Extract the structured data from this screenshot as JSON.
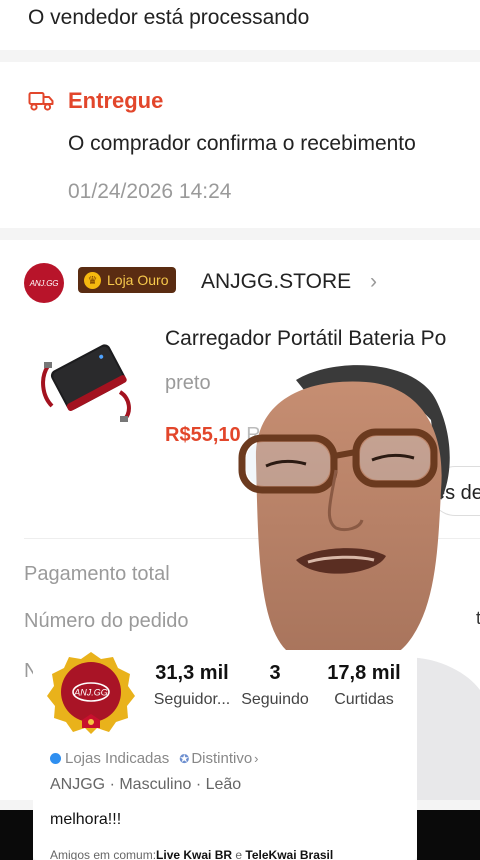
{
  "status": {
    "processing_text": "O vendedor está processando",
    "delivered_title": "Entregue",
    "delivered_desc": "O comprador confirma o recebimento",
    "delivered_time": "01/24/2026 14:24"
  },
  "store": {
    "logo_text": "ANJ.GG",
    "badge_label": "Loja Ouro",
    "name": "ANJGG.STORE",
    "chevron": "›"
  },
  "product": {
    "title": "Carregador Portátil Bateria Po",
    "variant": "preto",
    "price": "R$55,10",
    "price_extra": "R$",
    "details_button": "es de"
  },
  "summary": {
    "total_label": "Pagamento total",
    "order_label": "Número do pedido",
    "cut_label": "N",
    "side_mark": "t"
  },
  "profile": {
    "stats": [
      {
        "value": "31,3 mil",
        "label": "Seguidor..."
      },
      {
        "value": "3",
        "label": "Seguindo"
      },
      {
        "value": "17,8 mil",
        "label": "Curtidas"
      }
    ],
    "tag_stores": "Lojas Indicadas",
    "tag_badge": "Distintivo",
    "tag_chevron": "›",
    "meta": "ANJGG · Masculino · Leão",
    "bio": "melhora!!!",
    "mutual_prefix": "Amigos em comum:",
    "mutual_name1": "Live Kwai BR",
    "mutual_sep": " e ",
    "mutual_name2": "TeleKwai Brasil"
  },
  "colors": {
    "accent": "#e2462b",
    "store_brand": "#b8142a",
    "gold_badge_bg": "#5a2c12",
    "gold_badge_text": "#f7c94c"
  },
  "icons": {
    "delivery": "truck-icon",
    "store_badge": "crown-coin-icon",
    "store_nav": "chevron-right-icon",
    "verified": "verified-icon",
    "distinction": "badge-icon"
  }
}
